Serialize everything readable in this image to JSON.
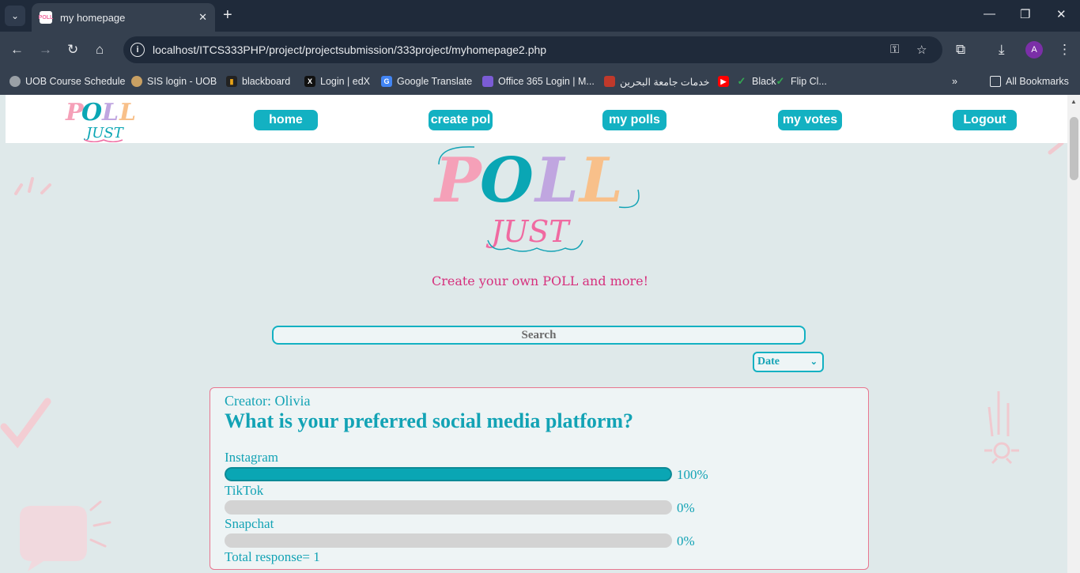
{
  "browser": {
    "tab_title": "my homepage",
    "url": "localhost/ITCS333PHP/project/projectsubmission/333project/myhomepage2.php",
    "avatar_letter": "A",
    "bookmarks": [
      {
        "label": "UOB Course Schedule",
        "icon": "globe-icon",
        "color": "#9aa0a6"
      },
      {
        "label": "SIS login - UOB",
        "icon": "sis-icon",
        "color": "#c9a063"
      },
      {
        "label": "blackboard",
        "icon": "blackboard-icon",
        "color": "#e8a317"
      },
      {
        "label": "Login | edX",
        "icon": "edx-icon",
        "color": "#111111"
      },
      {
        "label": "Google Translate",
        "icon": "translate-icon",
        "color": "#4285f4"
      },
      {
        "label": "Office 365 Login | M...",
        "icon": "office-icon",
        "color": "#7b5cd6"
      },
      {
        "label": "خدمات جامعة البحرين",
        "icon": "uob-icon",
        "color": "#c0392b"
      },
      {
        "label": "",
        "icon": "youtube-icon",
        "color": "#ff0000"
      },
      {
        "label": "Black",
        "icon": "check-icon",
        "color": "#34a853"
      },
      {
        "label": "Flip Cl...",
        "icon": "check-icon",
        "color": "#34a853"
      }
    ],
    "all_bookmarks": "All Bookmarks"
  },
  "site": {
    "logo_top": "POLL",
    "logo_bottom": "JUST",
    "nav": [
      "home",
      "create pol",
      "my polls",
      "my votes",
      "Logout"
    ],
    "tagline": "Create your own POLL and more!",
    "search_placeholder": "Search",
    "sort_value": "Date"
  },
  "poll": {
    "creator": "Creator: Olivia",
    "question": "What is your preferred social media platform?",
    "options": [
      {
        "label": "Instagram",
        "percent_text": "100%",
        "fraction": 1.0
      },
      {
        "label": "TikTok",
        "percent_text": "0%",
        "fraction": 0.0
      },
      {
        "label": "Snapchat",
        "percent_text": "0%",
        "fraction": 0.0
      }
    ],
    "total": "Total response= 1"
  },
  "colors": {
    "accent": "#13b1c2",
    "tagline": "#d6307d",
    "card_border": "#e8768f",
    "logo_pink": "#f5a0b8",
    "logo_teal": "#0aa6b4",
    "logo_lavender": "#c0a6e0",
    "logo_peach": "#f8c08a"
  }
}
